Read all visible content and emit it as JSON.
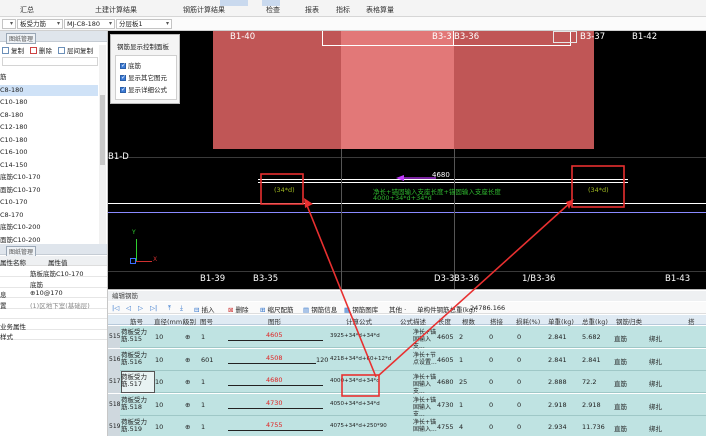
{
  "menu": {
    "items": [
      "汇总",
      "土建计算结果",
      "钢筋计算结果",
      "检查",
      "报表",
      "指标",
      "表格算量"
    ]
  },
  "selectors": {
    "floor": "",
    "component_type": "板受力筋",
    "component_name": "MJ-C8-180",
    "layer": "分层板1"
  },
  "left_panel": {
    "header": "图纸管理",
    "tools": {
      "add": "复制",
      "delete": "删除",
      "layer_copy": "层间复制"
    },
    "tree_items": [
      {
        "label": "筋",
        "selected": false
      },
      {
        "label": "C8-180",
        "selected": true
      },
      {
        "label": "C10-180",
        "selected": false
      },
      {
        "label": "C8-180",
        "selected": false
      },
      {
        "label": "C12-180",
        "selected": false
      },
      {
        "label": "C10-180",
        "selected": false
      },
      {
        "label": "C16-100",
        "selected": false
      },
      {
        "label": "C14-150",
        "selected": false
      },
      {
        "label": "底筋C10-170",
        "selected": false
      },
      {
        "label": "面筋C10-170",
        "selected": false
      },
      {
        "label": "C10-170",
        "selected": false
      },
      {
        "label": "C8-170",
        "selected": false
      },
      {
        "label": "底筋C10-200",
        "selected": false
      },
      {
        "label": "面筋C10-200",
        "selected": false
      }
    ],
    "props_header": "图纸管理",
    "prop_col_name": "属性名称",
    "prop_col_value": "属性值",
    "props": [
      {
        "key": "",
        "value": "筋板底筋C10-170",
        "gray": false
      },
      {
        "key": "",
        "value": "底筋",
        "gray": false
      },
      {
        "key": "息",
        "value": "⊕10@170",
        "gray": false
      },
      {
        "key": "置",
        "value": "(1)区地下室(基础层)",
        "gray": true
      },
      {
        "key": "",
        "value": "",
        "gray": false
      },
      {
        "key": "业务属性",
        "value": "",
        "gray": false
      },
      {
        "key": "样式",
        "value": "",
        "gray": false
      }
    ]
  },
  "canvas": {
    "axis_labels": {
      "top": [
        "B1-40",
        "B3-3",
        "B3-37",
        "B1-42"
      ],
      "top_mid": "B3-36",
      "left": "B1-D",
      "bottom": [
        "B1-39",
        "B3-35",
        "D3-3",
        "B3-36",
        "1/B3-36",
        "B1-43"
      ]
    },
    "dimension": "4680",
    "rebar_text_green_1": "净长+锚固输入支座长度+锚固输入支座长度",
    "rebar_text_green_2": "4000+34*d+34*d",
    "left_anchor": "(34*d)",
    "right_anchor": "(34*d)",
    "ucs": {
      "x": "X",
      "y": "Y"
    }
  },
  "control_panel": {
    "title": "钢筋显示控制面板",
    "options": [
      "底筋",
      "显示其它图元",
      "显示详细公式"
    ]
  },
  "editor": {
    "title": "编辑钢筋",
    "tools": [
      "插入",
      "删除",
      "缩尺配筋",
      "钢筋信息",
      "钢筋图库",
      "其他 ·",
      "单构件钢筋总重(kg):",
      "24786.166"
    ],
    "columns": [
      "筋号",
      "直径(mm)",
      "级别",
      "图号",
      "图形",
      "计算公式",
      "公式描述",
      "长度",
      "根数",
      "搭接",
      "损耗(%)",
      "单重(kg)",
      "总重(kg)",
      "钢筋归类",
      "搭"
    ],
    "rows": [
      {
        "no": "515",
        "name": "荷板受力筋.515",
        "dia": "10",
        "grade": "⊕",
        "fig": "1",
        "shape_val": "4605",
        "shape_extra": "",
        "formula": "3925+34*d+34*d",
        "desc": "净长+锚固输入支...",
        "len": "4605",
        "count": "2",
        "lap": "0",
        "loss": "0",
        "unit_w": "2.841",
        "total_w": "5.682",
        "cls": "直筋",
        "ext": "绑扎"
      },
      {
        "no": "516",
        "name": "荷板受力筋.516",
        "dia": "10",
        "grade": "⊕",
        "fig": "601",
        "shape_val": "4508",
        "shape_extra": "120",
        "formula": "4218+34*d+60+12*d",
        "desc": "净长+节点设置...",
        "len": "4605",
        "count": "1",
        "lap": "0",
        "loss": "0",
        "unit_w": "2.841",
        "total_w": "2.841",
        "cls": "直筋",
        "ext": "绑扎"
      },
      {
        "no": "517",
        "name": "荷板受力筋.517",
        "dia": "10",
        "grade": "⊕",
        "fig": "1",
        "shape_val": "4680",
        "shape_extra": "",
        "formula": "4000+34*d+34*d",
        "desc": "净长+锚固输入支...",
        "len": "4680",
        "count": "25",
        "lap": "0",
        "loss": "0",
        "unit_w": "2.888",
        "total_w": "72.2",
        "cls": "直筋",
        "ext": "绑扎"
      },
      {
        "no": "518",
        "name": "荷板受力筋.518",
        "dia": "10",
        "grade": "⊕",
        "fig": "1",
        "shape_val": "4730",
        "shape_extra": "",
        "formula": "4050+34*d+34*d",
        "desc": "净长+锚固输入支...",
        "len": "4730",
        "count": "1",
        "lap": "0",
        "loss": "0",
        "unit_w": "2.918",
        "total_w": "2.918",
        "cls": "直筋",
        "ext": "绑扎"
      },
      {
        "no": "519",
        "name": "荷板受力筋.519",
        "dia": "10",
        "grade": "⊕",
        "fig": "1",
        "shape_val": "4755",
        "shape_extra": "",
        "formula": "4075+34*d+250*90",
        "desc": "净长+锚固输入...",
        "len": "4755",
        "count": "4",
        "lap": "0",
        "loss": "0",
        "unit_w": "2.934",
        "total_w": "11.736",
        "cls": "直筋",
        "ext": "绑扎"
      }
    ]
  },
  "colors": {
    "canvas_bg": "#000000",
    "beam_red": "#c05656",
    "beam_light": "#e27878",
    "arrow_red": "#e83030",
    "grid_row": "#bfe3e2",
    "rebar_green": "#2fb82f"
  }
}
